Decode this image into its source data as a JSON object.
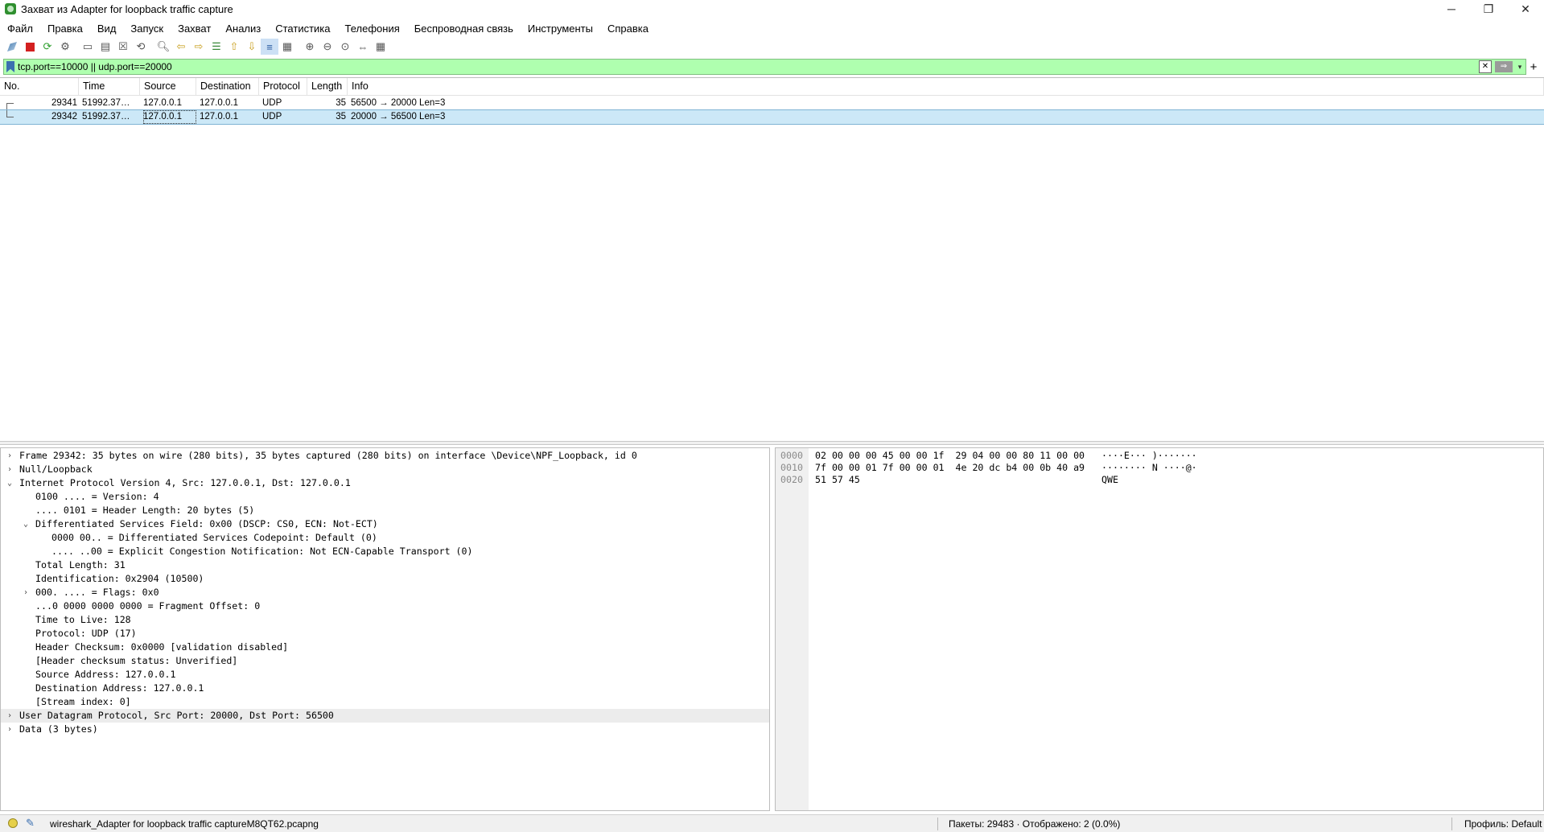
{
  "window": {
    "title": "Захват из Adapter for loopback traffic capture",
    "minimize_icon": "minimize-icon",
    "maximize_icon": "restore-icon",
    "close_icon": "close-icon"
  },
  "menu": [
    "Файл",
    "Правка",
    "Вид",
    "Запуск",
    "Захват",
    "Анализ",
    "Статистика",
    "Телефония",
    "Беспроводная связь",
    "Инструменты",
    "Справка"
  ],
  "filter": {
    "value": "tcp.port==10000 || udp.port==20000",
    "bg_color": "#afffaf"
  },
  "packet_list": {
    "columns": [
      "No.",
      "Time",
      "Source",
      "Destination",
      "Protocol",
      "Length",
      "Info"
    ],
    "rows": [
      {
        "no": "29341",
        "time": "51992.37…",
        "source": "127.0.0.1",
        "destination": "127.0.0.1",
        "protocol": "UDP",
        "length": "35",
        "info": "56500 → 20000 Len=3"
      },
      {
        "no": "29342",
        "time": "51992.37…",
        "source": "127.0.0.1",
        "destination": "127.0.0.1",
        "protocol": "UDP",
        "length": "35",
        "info": "20000 → 56500 Len=3"
      }
    ],
    "selected_row": 1,
    "selected_color": "#cce8f7"
  },
  "details": [
    {
      "text": "Frame 29342: 35 bytes on wire (280 bits), 35 bytes captured (280 bits) on interface \\Device\\NPF_Loopback, id 0",
      "indent": 0,
      "arrow": "›"
    },
    {
      "text": "Null/Loopback",
      "indent": 0,
      "arrow": "›"
    },
    {
      "text": "Internet Protocol Version 4, Src: 127.0.0.1, Dst: 127.0.0.1",
      "indent": 0,
      "arrow": "⌄"
    },
    {
      "text": "0100 .... = Version: 4",
      "indent": 1,
      "arrow": ""
    },
    {
      "text": ".... 0101 = Header Length: 20 bytes (5)",
      "indent": 1,
      "arrow": ""
    },
    {
      "text": "Differentiated Services Field: 0x00 (DSCP: CS0, ECN: Not-ECT)",
      "indent": 1,
      "arrow": "⌄"
    },
    {
      "text": "0000 00.. = Differentiated Services Codepoint: Default (0)",
      "indent": 2,
      "arrow": ""
    },
    {
      "text": ".... ..00 = Explicit Congestion Notification: Not ECN-Capable Transport (0)",
      "indent": 2,
      "arrow": ""
    },
    {
      "text": "Total Length: 31",
      "indent": 1,
      "arrow": ""
    },
    {
      "text": "Identification: 0x2904 (10500)",
      "indent": 1,
      "arrow": ""
    },
    {
      "text": "000. .... = Flags: 0x0",
      "indent": 1,
      "arrow": "›"
    },
    {
      "text": "...0 0000 0000 0000 = Fragment Offset: 0",
      "indent": 1,
      "arrow": ""
    },
    {
      "text": "Time to Live: 128",
      "indent": 1,
      "arrow": ""
    },
    {
      "text": "Protocol: UDP (17)",
      "indent": 1,
      "arrow": ""
    },
    {
      "text": "Header Checksum: 0x0000 [validation disabled]",
      "indent": 1,
      "arrow": ""
    },
    {
      "text": "[Header checksum status: Unverified]",
      "indent": 1,
      "arrow": ""
    },
    {
      "text": "Source Address: 127.0.0.1",
      "indent": 1,
      "arrow": ""
    },
    {
      "text": "Destination Address: 127.0.0.1",
      "indent": 1,
      "arrow": ""
    },
    {
      "text": "[Stream index: 0]",
      "indent": 1,
      "arrow": ""
    },
    {
      "text": "User Datagram Protocol, Src Port: 20000, Dst Port: 56500",
      "indent": 0,
      "arrow": "›",
      "highlight": true
    },
    {
      "text": "Data (3 bytes)",
      "indent": 0,
      "arrow": "›"
    }
  ],
  "bytes": [
    {
      "offset": "0000",
      "hex": "02 00 00 00 45 00 00 1f  29 04 00 00 80 11 00 00",
      "ascii": "····E··· )·······"
    },
    {
      "offset": "0010",
      "hex": "7f 00 00 01 7f 00 00 01  4e 20 dc b4 00 0b 40 a9",
      "ascii": "········ N ····@·"
    },
    {
      "offset": "0020",
      "hex": "51 57 45",
      "ascii": "QWE"
    }
  ],
  "status": {
    "file": "wireshark_Adapter for loopback traffic captureM8QT62.pcapng",
    "packets": "Пакеты: 29483 · Отображено: 2 (0.0%)",
    "profile": "Профиль: Default"
  }
}
